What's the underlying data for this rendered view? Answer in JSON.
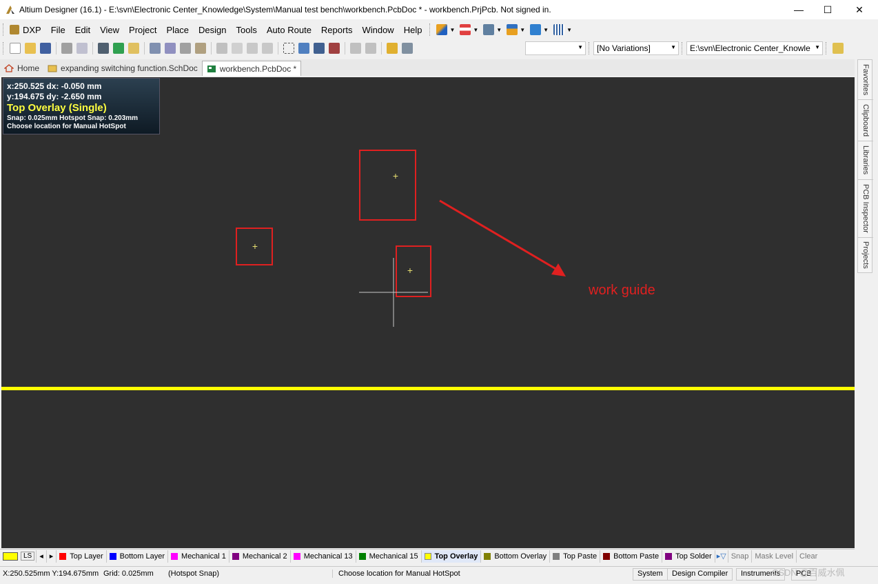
{
  "window": {
    "title": "Altium Designer (16.1) - E:\\svn\\Electronic Center_Knowledge\\System\\Manual test bench\\workbench.PcbDoc * - workbench.PrjPcb. Not signed in.",
    "minimize": "—",
    "maximize": "☐",
    "close": "✕"
  },
  "menu": {
    "items": [
      "DXP",
      "File",
      "Edit",
      "View",
      "Project",
      "Place",
      "Design",
      "Tools",
      "Auto Route",
      "Reports",
      "Window",
      "Help"
    ]
  },
  "toolbar": {
    "combo_empty": "",
    "variations": "[No Variations]",
    "path": "E:\\svn\\Electronic Center_Knowle"
  },
  "doc_tabs": [
    {
      "label": "Home",
      "icon": "home-icon"
    },
    {
      "label": "expanding switching function.SchDoc",
      "icon": "folder-icon"
    },
    {
      "label": "workbench.PcbDoc *",
      "icon": "pcb-icon"
    }
  ],
  "hud": {
    "line1": "x:250.525   dx: -0.050 mm",
    "line2": "y:194.675   dy: -2.650  mm",
    "layer": "Top Overlay (Single)",
    "snap": "Snap: 0.025mm Hotspot Snap: 0.203mm",
    "hint": "Choose location for Manual HotSpot"
  },
  "canvas": {
    "annotation": "work guide",
    "annotation_color": "#e02020",
    "crosshair_color": "#e8e070"
  },
  "right_panel": [
    "Favorites",
    "Clipboard",
    "Libraries",
    "PCB Inspector",
    "Projects"
  ],
  "layer_tabs": {
    "current": "LS",
    "current_color": "#ffff00",
    "layers": [
      {
        "label": "Top Layer",
        "color": "#ff0000"
      },
      {
        "label": "Bottom Layer",
        "color": "#0000ff"
      },
      {
        "label": "Mechanical 1",
        "color": "#ff00ff"
      },
      {
        "label": "Mechanical 2",
        "color": "#800080"
      },
      {
        "label": "Mechanical 13",
        "color": "#ff00ff"
      },
      {
        "label": "Mechanical 15",
        "color": "#008000"
      },
      {
        "label": "Top Overlay",
        "color": "#ffff00"
      },
      {
        "label": "Bottom Overlay",
        "color": "#808000"
      },
      {
        "label": "Top Paste",
        "color": "#808080"
      },
      {
        "label": "Bottom Paste",
        "color": "#800000"
      },
      {
        "label": "Top Solder",
        "color": "#800080"
      }
    ],
    "snap": "Snap",
    "mask_level": "Mask Level",
    "clear": "Clear"
  },
  "status": {
    "coords": "X:250.525mm Y:194.675mm",
    "grid": "Grid: 0.025mm",
    "snap_mode": "(Hotspot Snap)",
    "message": "Choose location for Manual HotSpot",
    "system": "System",
    "design_compiler": "Design Compiler",
    "instruments": "Instruments",
    "pcb": "PCB",
    "watermark": "CSDN @百威水佩"
  }
}
